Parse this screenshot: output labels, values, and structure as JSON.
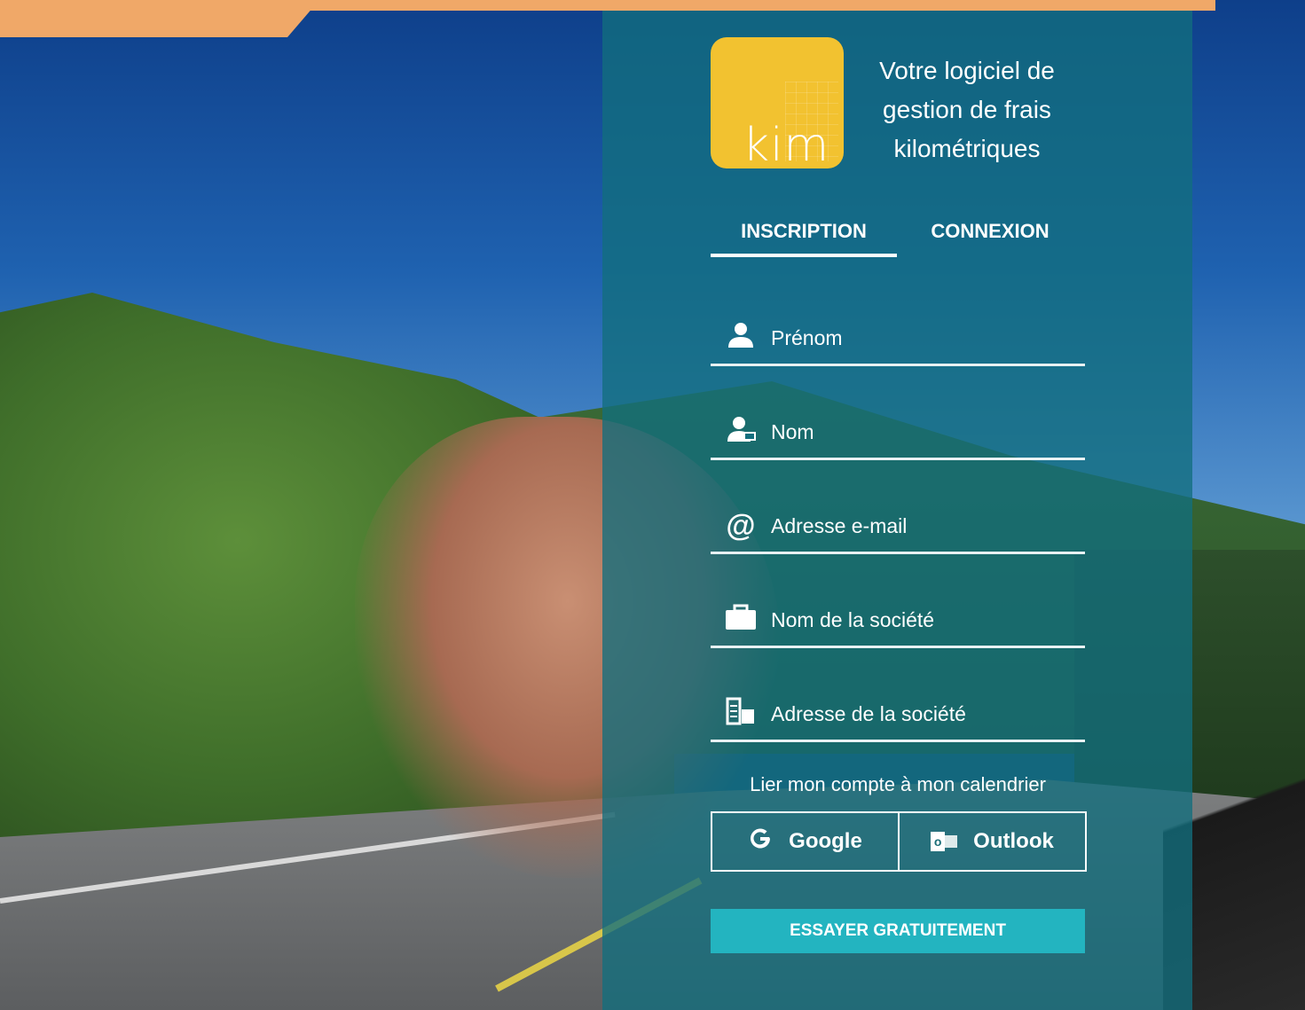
{
  "brand": {
    "logo_text": "kim",
    "tagline": [
      "Votre logiciel de",
      "gestion de frais",
      "kilométriques"
    ]
  },
  "tabs": [
    {
      "label": "INSCRIPTION",
      "active": true
    },
    {
      "label": "CONNEXION",
      "active": false
    }
  ],
  "form": {
    "fields": [
      {
        "icon": "user-icon",
        "placeholder": "Prénom",
        "value": ""
      },
      {
        "icon": "user-stamp-icon",
        "placeholder": "Nom",
        "value": ""
      },
      {
        "icon": "at-icon",
        "placeholder": "Adresse e-mail",
        "value": ""
      },
      {
        "icon": "briefcase-icon",
        "placeholder": "Nom de la société",
        "value": ""
      },
      {
        "icon": "building-icon",
        "placeholder": "Adresse de la société",
        "value": ""
      }
    ],
    "calendar_label": "Lier mon compte à mon calendrier",
    "google_label": "Google",
    "outlook_label": "Outlook",
    "submit_label": "ESSAYER GRATUITEMENT"
  },
  "colors": {
    "accent_orange": "#f0a868",
    "panel_teal": "#126e7d",
    "logo_yellow": "#f2c230",
    "cta_teal": "#23b4c0"
  }
}
